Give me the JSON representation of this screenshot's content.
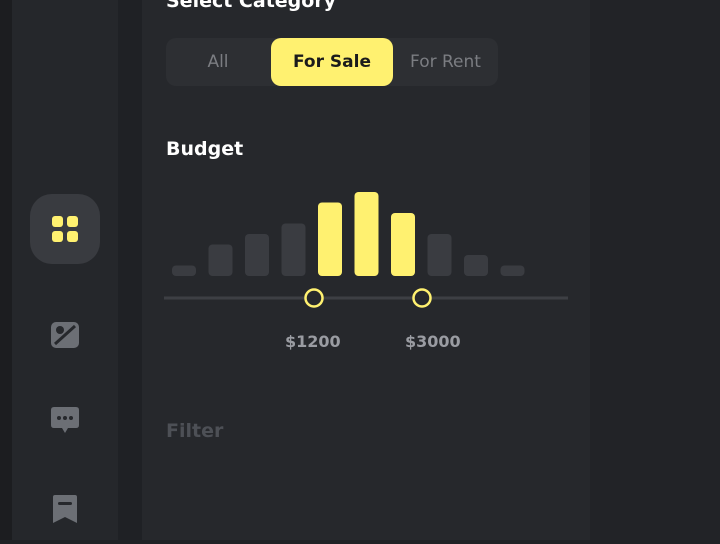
{
  "filters": {
    "category_title": "Select Category",
    "categories": [
      {
        "label": "All",
        "active": false
      },
      {
        "label": "For Sale",
        "active": true
      },
      {
        "label": "For Rent",
        "active": false
      }
    ],
    "budget_title": "Budget",
    "filter_title": "Filter"
  },
  "sidebar": {
    "items": [
      {
        "icon": "grid-icon",
        "active": true
      },
      {
        "icon": "map-icon",
        "active": false
      },
      {
        "icon": "chat-icon",
        "active": false
      },
      {
        "icon": "bookmark-icon",
        "active": false
      }
    ]
  },
  "colors": {
    "accent": "#fff170",
    "bar_inactive": "#3a3c41",
    "background": "#26282c"
  },
  "chart_data": {
    "type": "bar",
    "values": [
      1,
      3,
      4,
      5,
      7,
      8,
      6,
      4,
      2,
      1
    ],
    "selected_range_values": [
      "$1200",
      "$3000"
    ],
    "selected_bar_indices": [
      4,
      5,
      6
    ]
  }
}
